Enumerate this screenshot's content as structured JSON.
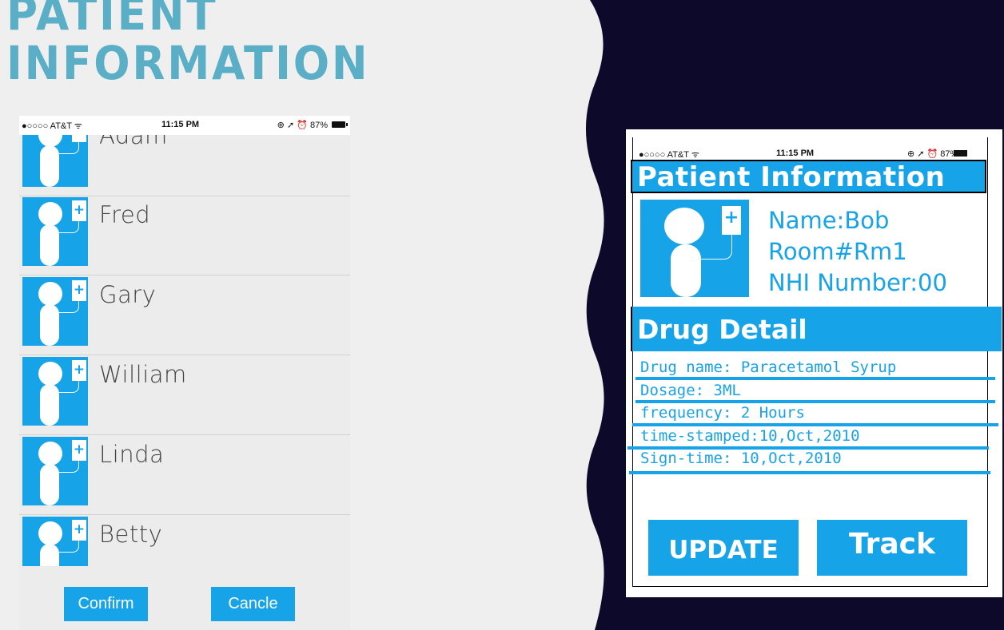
{
  "slide": {
    "title_line1": "PATIENT",
    "title_line2": "INFORMATION",
    "colors": {
      "accent": "#5aafc7",
      "dark": "#0c092a",
      "light": "#efefef",
      "ui_blue": "#17a3e8"
    }
  },
  "left_phone": {
    "status": {
      "carrier": "●○○○○ AT&T ᯤ",
      "time": "11:15 PM",
      "right": "⊕ ➚ ⏰ 87%"
    },
    "patients": [
      "Adam",
      "Fred",
      "Gary",
      "William",
      "Linda",
      "Betty"
    ],
    "avatar_icon": "patient-iv-icon",
    "confirm_label": "Confirm",
    "cancel_label": "Cancle"
  },
  "right_phone": {
    "status": {
      "carrier": "●○○○○ AT&T ᯤ",
      "time": "11:15 PM",
      "right": "⊕ ➚ ⏰ 87%"
    },
    "header": "Patient Information",
    "name": "Name:Bob",
    "room": "Room#Rm1",
    "nhi": "NHI Number:00",
    "section": "Drug Detail",
    "drug_name": "Drug name: Paracetamol Syrup",
    "dosage": "Dosage: 3ML",
    "frequency": "frequency: 2 Hours",
    "time_stamped": "time-stamped:10,Oct,2010",
    "sign_time": "Sign-time: 10,Oct,2010",
    "update_label": "UPDATE",
    "track_label": "Track"
  }
}
